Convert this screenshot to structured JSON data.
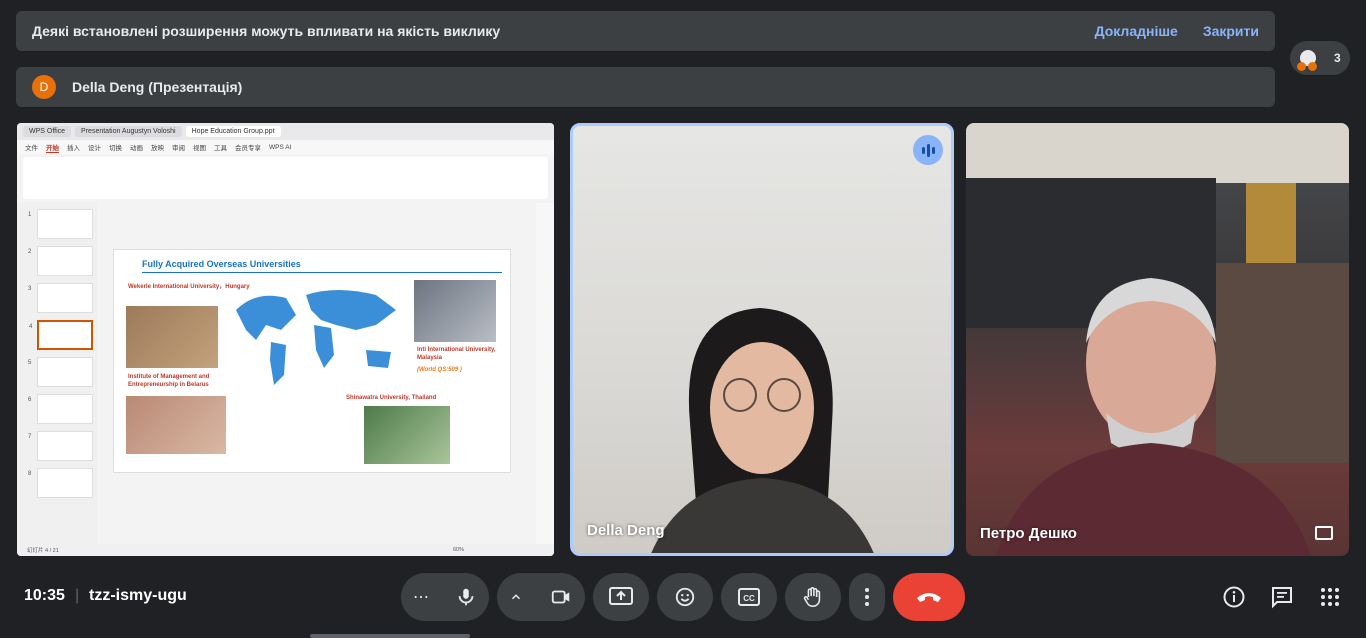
{
  "banner": {
    "message": "Деякі встановлені розширення можуть впливати на якість виклику",
    "learn_more": "Докладніше",
    "close": "Закрити"
  },
  "presentation": {
    "avatar_letter": "D",
    "title": "Della Deng (Презентація)"
  },
  "people": {
    "count": "3"
  },
  "participants": [
    {
      "name": "Della Deng"
    },
    {
      "name": "Петро Дешко"
    }
  ],
  "screen_share": {
    "tabs": [
      "WPS Office",
      "Presentation Augustyn Voloshi",
      "Hope Education Group.ppt"
    ],
    "menu": [
      "文件",
      "开始",
      "插入",
      "设计",
      "切换",
      "动画",
      "放映",
      "审阅",
      "视图",
      "工具",
      "会员专享",
      "WPS AI"
    ],
    "slide_title": "Fully Acquired Overseas Universities",
    "universities": [
      "Wekerle International University，Hungary",
      "Institute of Management and Entrepreneurship in Belarus",
      "Inti International University, Malaysia",
      "(World QS:509 )",
      "Shinawatra University, Thailand"
    ],
    "thumb_numbers": [
      "1",
      "2",
      "3",
      "4",
      "5",
      "6",
      "7",
      "8"
    ],
    "status_slide": "幻灯片 4 / 21",
    "status_zoom": "60%"
  },
  "meeting": {
    "time": "10:35",
    "separator": "|",
    "code": "tzz-ismy-ugu"
  },
  "icons": {
    "more_options": "more-horiz-icon",
    "mic": "mic-icon",
    "camera": "videocam-icon",
    "present": "present-screen-icon",
    "reactions": "emoji-icon",
    "captions": "captions-icon",
    "raise_hand": "hand-icon",
    "more_vert": "more-vert-icon",
    "end_call": "call-end-icon",
    "info": "info-icon",
    "chat": "chat-icon",
    "activities": "apps-icon"
  },
  "colors": {
    "accent": "#8ab4f8",
    "end_call": "#ea4335",
    "surface": "#3c4043",
    "background": "#202124"
  }
}
